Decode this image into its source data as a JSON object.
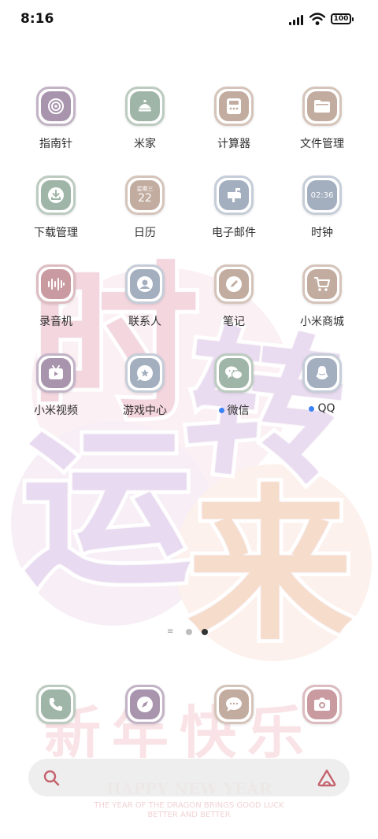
{
  "status_bar": {
    "time": "8:16",
    "battery": "100"
  },
  "apps": [
    {
      "label": "指南针",
      "icon": "compass-dial-icon"
    },
    {
      "label": "米家",
      "icon": "smart-home-icon"
    },
    {
      "label": "计算器",
      "icon": "calculator-icon"
    },
    {
      "label": "文件管理",
      "icon": "folder-icon"
    },
    {
      "label": "下载管理",
      "icon": "download-icon"
    },
    {
      "label": "日历",
      "icon": "calendar-icon",
      "icon_text_top": "星期三",
      "icon_text_main": "22"
    },
    {
      "label": "电子邮件",
      "icon": "mailbox-icon"
    },
    {
      "label": "时钟",
      "icon": "clock-icon",
      "icon_text_main": "02:36"
    },
    {
      "label": "录音机",
      "icon": "sound-wave-icon"
    },
    {
      "label": "联系人",
      "icon": "contact-icon"
    },
    {
      "label": "笔记",
      "icon": "pencil-icon"
    },
    {
      "label": "小米商城",
      "icon": "shopping-cart-icon"
    },
    {
      "label": "小米视频",
      "icon": "video-icon"
    },
    {
      "label": "游戏中心",
      "icon": "game-star-icon"
    },
    {
      "label": "微信",
      "icon": "wechat-icon",
      "new_badge": true
    },
    {
      "label": "QQ",
      "icon": "qq-penguin-icon",
      "new_badge": true
    }
  ],
  "page_indicator": {
    "pages": 2,
    "current": 2
  },
  "dock": [
    {
      "icon": "phone-icon"
    },
    {
      "icon": "browser-compass-icon"
    },
    {
      "icon": "message-icon"
    },
    {
      "icon": "camera-icon"
    }
  ],
  "wallpaper": {
    "big_characters": [
      "时",
      "转",
      "运",
      "来"
    ],
    "bottom_characters": "新年快乐",
    "greeting": "HAPPY NEW YEAR",
    "greeting_sub_1": "THE YEAR OF THE DRAGON BRINGS GOOD LUCK",
    "greeting_sub_2": "BETTER AND BETTER"
  },
  "colors": {
    "mauve": "#a895ad",
    "sage": "#9fb5a7",
    "taupe": "#c2aca0",
    "slate": "#a3aebf",
    "rose": "#c99aa0",
    "badge_blue": "#3b82f6"
  }
}
